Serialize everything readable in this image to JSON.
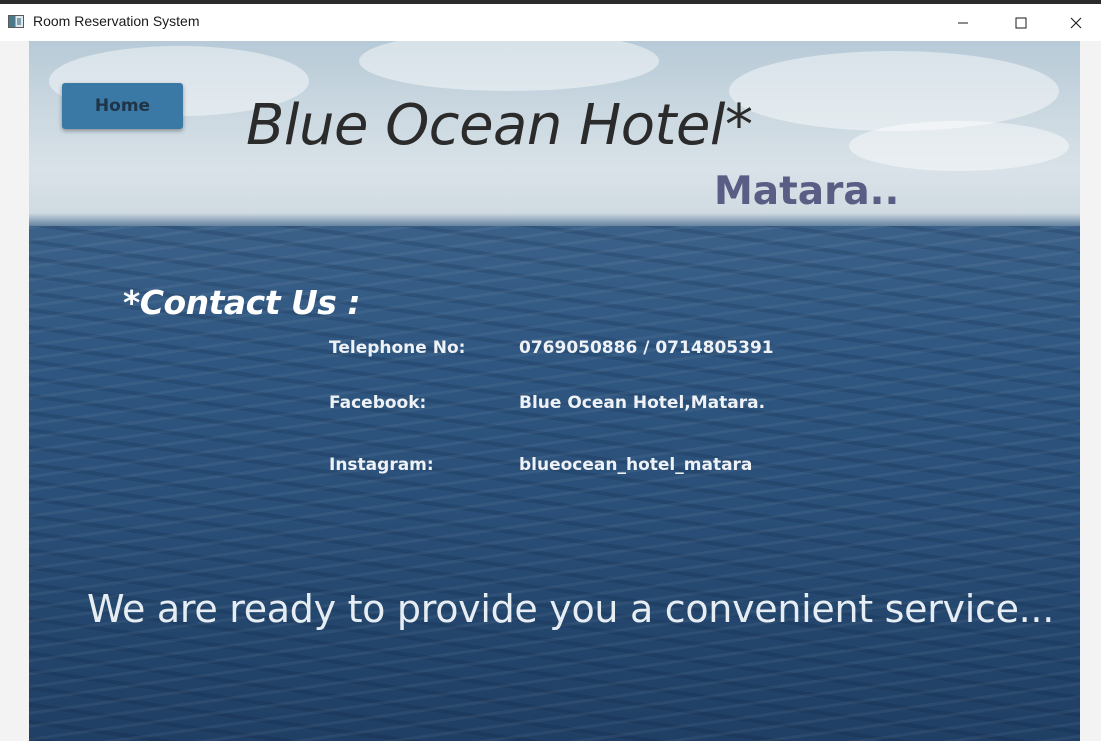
{
  "window": {
    "title": "Room Reservation System",
    "controls": {
      "minimize": "minimize-icon",
      "maximize": "maximize-icon",
      "close": "close-icon"
    }
  },
  "nav": {
    "home_label": "Home"
  },
  "header": {
    "hotel_name": "Blue Ocean Hotel*",
    "city": "Matara.."
  },
  "contact": {
    "heading": "*Contact Us :",
    "items": [
      {
        "label": "Telephone No:",
        "value": "0769050886 / 0714805391"
      },
      {
        "label": "Facebook:",
        "value": "Blue Ocean Hotel,Matara."
      },
      {
        "label": "Instagram:",
        "value": "blueocean_hotel_matara"
      }
    ]
  },
  "tagline": "We are ready to provide you a convenient service...",
  "colors": {
    "home_button": "#3a79a6",
    "city_text": "#5a5e85",
    "title_text": "#2b2b2b",
    "contact_text": "#ffffff"
  }
}
